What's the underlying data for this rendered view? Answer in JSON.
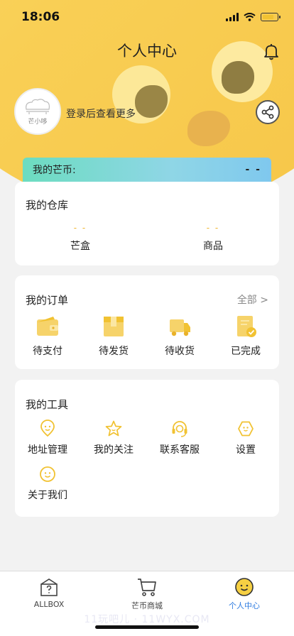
{
  "status": {
    "time": "18:06"
  },
  "header": {
    "title": "个人中心"
  },
  "profile": {
    "avatar_label": "芒小哆",
    "login_prompt": "登录后查看更多"
  },
  "coins": {
    "label": "我的芒币:",
    "value": "- -"
  },
  "warehouse": {
    "title": "我的仓库",
    "items": [
      {
        "value": "- -",
        "label": "芒盒"
      },
      {
        "value": "- -",
        "label": "商品"
      }
    ]
  },
  "orders": {
    "title": "我的订单",
    "all_label": "全部 >",
    "items": [
      {
        "label": "待支付",
        "icon": "wallet-icon"
      },
      {
        "label": "待发货",
        "icon": "package-icon"
      },
      {
        "label": "待收货",
        "icon": "delivery-truck-icon"
      },
      {
        "label": "已完成",
        "icon": "completed-clipboard-icon"
      }
    ]
  },
  "tools": {
    "title": "我的工具",
    "items": [
      {
        "label": "地址管理",
        "icon": "location-icon"
      },
      {
        "label": "我的关注",
        "icon": "star-icon"
      },
      {
        "label": "联系客服",
        "icon": "headset-icon"
      },
      {
        "label": "设置",
        "icon": "settings-icon"
      },
      {
        "label": "关于我们",
        "icon": "smiley-icon"
      }
    ]
  },
  "tabbar": {
    "items": [
      {
        "label": "ALLBOX",
        "icon": "mystery-box-icon"
      },
      {
        "label": "芒币商城",
        "icon": "cart-icon"
      },
      {
        "label": "个人中心",
        "icon": "profile-smiley-icon",
        "active": true
      }
    ]
  },
  "watermark": "11玩吧儿 · 11WYX.COM",
  "colors": {
    "accent": "#f1c232",
    "active_tab": "#2d7be0",
    "card_bg": "#ffffff"
  }
}
